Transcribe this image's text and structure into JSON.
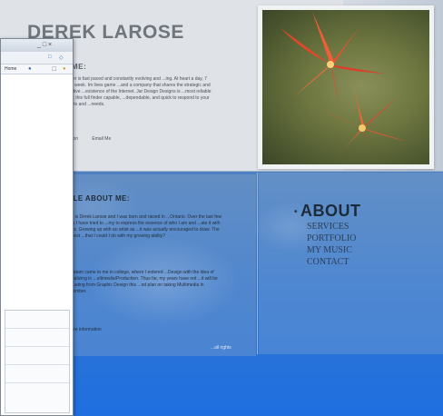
{
  "site": {
    "title": "DEREK LAROSE",
    "welcome": {
      "heading": "COME:",
      "body": "...career is fast paced and constantly evolving and ...ing. At heart a day, 7 days a week. Im lives game ...and a company that shares the strategic and innovative ...existence of the Internet. Jar Design Designs is ...most reliable choice; this full finder capable, ...dependable, and quick to respond to your requests and ...needs.",
      "links": [
        "definition",
        "Email Me"
      ]
    },
    "about": {
      "heading": "TTLE ABOUT ME:",
      "p1": "...me is Derek Larose and I was born and raised in ...Ontario. Over the last few years I have tried to ...my to express the essence of who I am and ...ate it with others. Growing up with an artist as ...it was actually encouraged to draw. The greatest ...that I could I do with my growing ability?",
      "p2": "...timatam came to me in college, where I entered ...Design with the idea of specializing in ...ultimedia/Production. Thus far, my years have not ...it will be graduating from Graphic Design this ...nd plan on taking Multimedia in September.",
      "p3": "...more information",
      "credit": "...all rights"
    },
    "nav": {
      "current": "ABOUT",
      "items": [
        "SERVICES",
        "PORTFOLIO",
        "MY MUSIC",
        "CONTACT"
      ]
    }
  },
  "browser": {
    "tab_label": "Home",
    "controls": "_ □ ×"
  },
  "colors": {
    "accent": "#2f76d2",
    "title_gray": "#6f757c"
  }
}
